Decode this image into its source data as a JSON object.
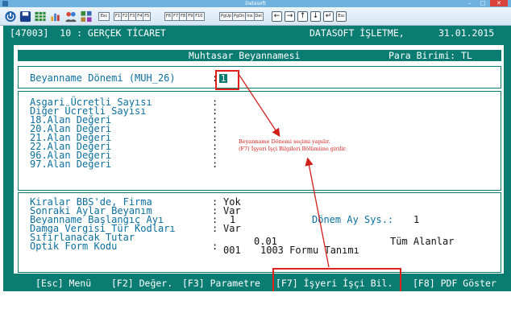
{
  "window": {
    "title": "Datasoft",
    "min": "–",
    "max": "□",
    "close": "✕"
  },
  "toolbar": {
    "esc": "Esc",
    "fkeys_a": [
      "F1",
      "F2",
      "F3",
      "F4",
      "F5"
    ],
    "fkeys_b": [
      "F6",
      "F7",
      "F8",
      "F9",
      "F10"
    ],
    "nav_keys": [
      "PgUp",
      "PgDn",
      "Ins",
      "Del"
    ],
    "arrows": [
      "←",
      "→",
      "↑",
      "↓",
      "↵",
      "Esc"
    ]
  },
  "header": {
    "left": "[47003]  10 : GERÇEK TİCARET",
    "company": "DATASOFT İŞLETME,",
    "date": "31.01.2015"
  },
  "form": {
    "title": "Muhtasar Beyannamesi",
    "currency": "Para Birimi: TL",
    "period_label": "Beyanname Dönemi (MUH_26)",
    "period_value": "1",
    "fields": [
      "Asgari Ücretli Sayısı",
      "Diğer Ücretli Sayısı",
      "18.Alan Değeri",
      "20.Alan Değeri",
      "21.Alan Değeri",
      "22.Alan Değeri",
      "96.Alan Değeri",
      "97.Alan Değeri"
    ],
    "options": [
      {
        "label": "Kiralar BBS'de, Firma",
        "value": "Yok"
      },
      {
        "label": "Sonraki Aylar Beyanım",
        "value": "Var"
      },
      {
        "label": "Beyanname Başlangıç Ayı",
        "value": "1"
      },
      {
        "label": "Damga Vergisi Tür Kodları",
        "value": "Var"
      },
      {
        "label": "Sıfırlanacak Tutar",
        "value": "0.01"
      },
      {
        "label": "Optik Form Kodu",
        "value": "001"
      }
    ],
    "donem_ay_label": "Dönem Ay Sys.:",
    "donem_ay_value": "1",
    "tum_alanlar": "Tüm Alanlar",
    "form_code": "1003 Formu Tanımı"
  },
  "annotation": {
    "line1": "Beyanname Dönemi seçimi yapılır.",
    "line2": "(F7) İşyeri İşçi Bilgileri Bölümüne girilir.",
    "color": "#d1201a"
  },
  "fnbar": {
    "esc": "[Esc] Menü",
    "f2": "[F2] Değer.",
    "f3": "[F3] Parametre",
    "f7": "[F7] İşyeri İşçi Bil.",
    "f8": "[F8] PDF Göster"
  },
  "colors": {
    "screen": "#0b7c72",
    "label": "#0b6f9e",
    "highlight": "#e0201a"
  }
}
